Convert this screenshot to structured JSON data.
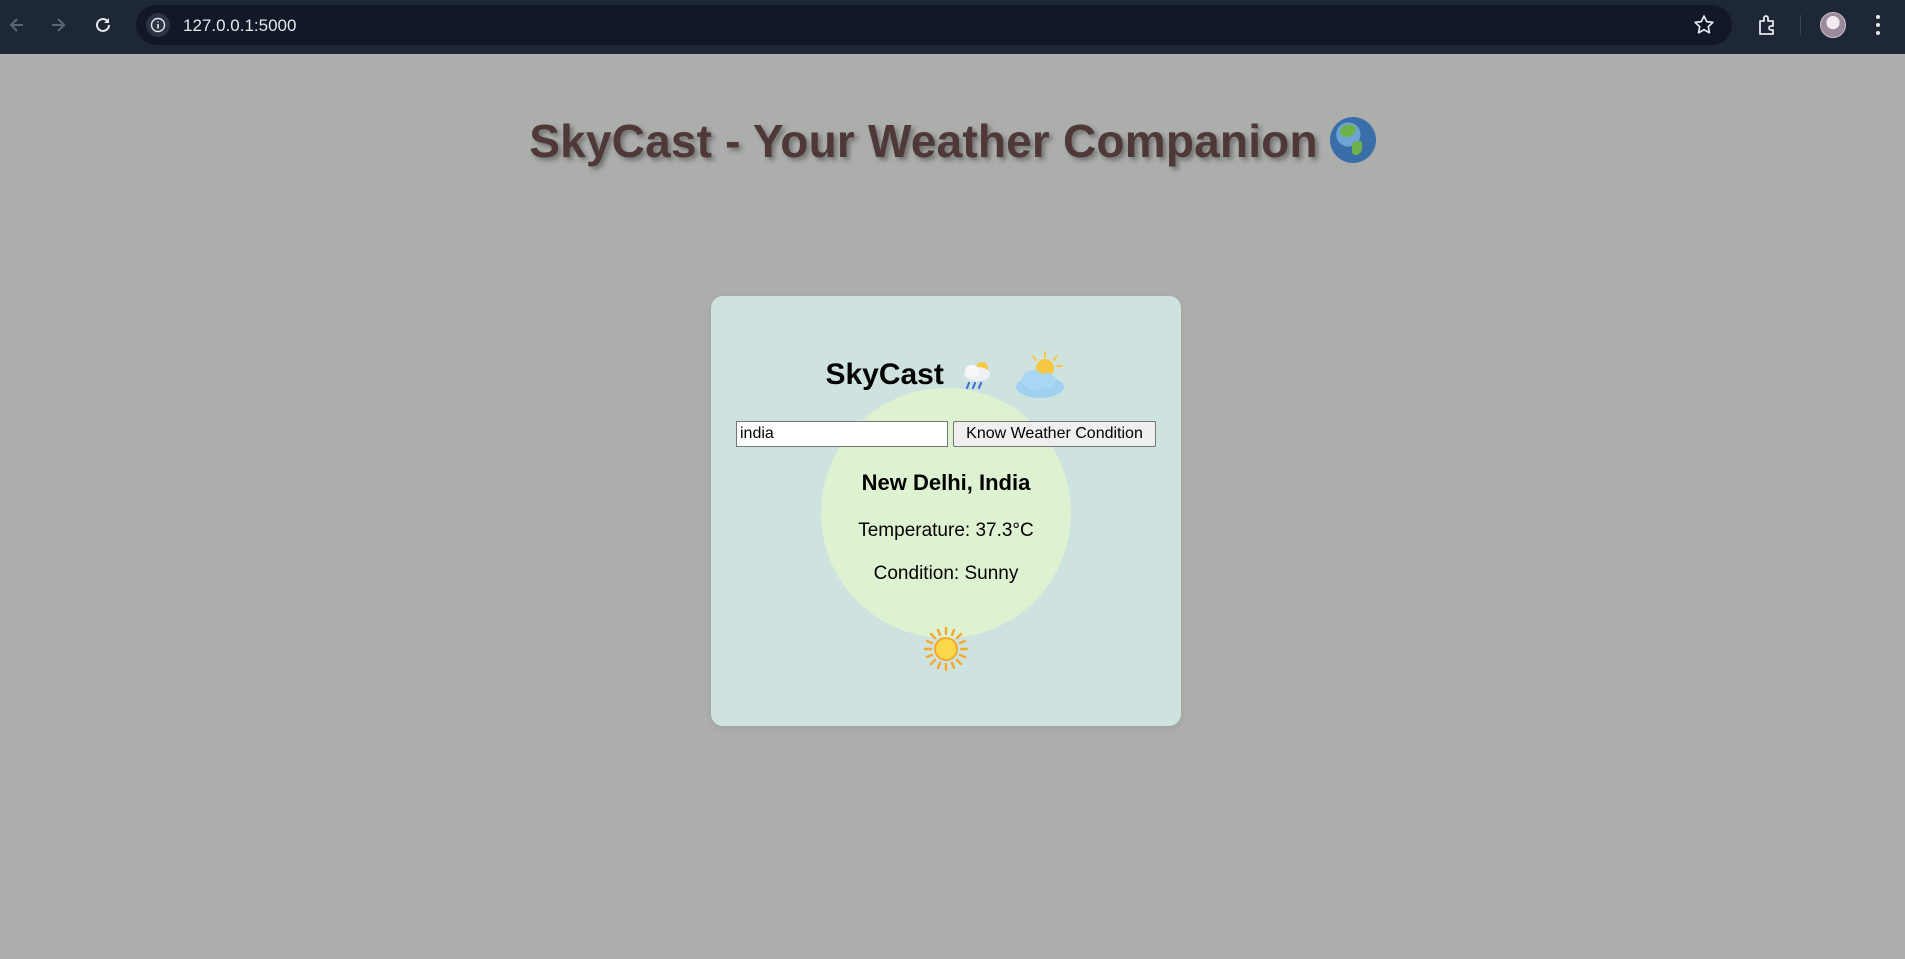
{
  "browser": {
    "url": "127.0.0.1:5000",
    "icons": [
      "back-icon",
      "forward-icon",
      "reload-icon",
      "site-info-icon",
      "bookmark-star-icon",
      "extensions-icon",
      "profile-avatar",
      "menu-icon"
    ]
  },
  "page": {
    "heading": "SkyCast - Your Weather Companion",
    "heading_emoji": "globe-icon"
  },
  "card": {
    "title": "SkyCast",
    "title_icons": [
      "cloud-rain-icon",
      "sun-behind-cloud-icon"
    ],
    "search": {
      "value": "india",
      "button_label": "Know Weather Condition"
    },
    "result": {
      "location": "New Delhi, India",
      "temperature": "Temperature: 37.3°C",
      "condition": "Condition: Sunny",
      "condition_icon": "sun-icon"
    }
  },
  "colors": {
    "background": "#acaeac",
    "heading": "#4f3838",
    "card": "#cee2e0",
    "glow": "#def2d1",
    "chrome": "#1e2736"
  }
}
